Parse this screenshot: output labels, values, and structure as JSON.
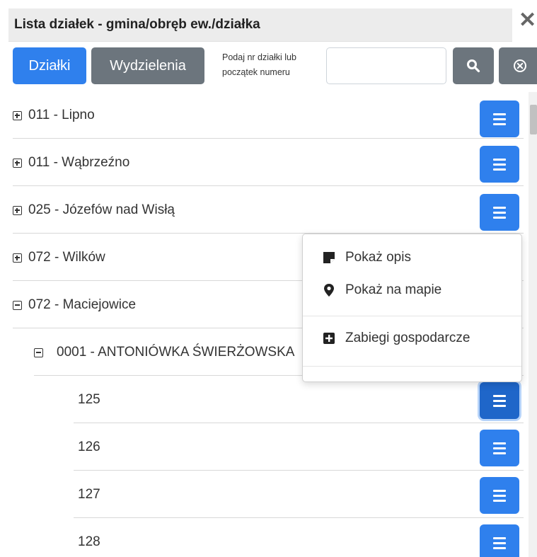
{
  "window": {
    "title": "Lista działek - gmina/obręb ew./działka",
    "close_symbol": "✕"
  },
  "toolbar": {
    "dzialki_label": "Działki",
    "wydzielenia_label": "Wydzielenia",
    "search_hint": "Podaj nr działki lub początek numeru",
    "search_value": "",
    "search_placeholder": "",
    "search_icon": "search-icon",
    "clear_icon": "clear-circle-icon"
  },
  "tree": {
    "rows": [
      {
        "label": "011 - Lipno",
        "toggle": "plus"
      },
      {
        "label": "011 - Wąbrzeźno",
        "toggle": "plus"
      },
      {
        "label": "025 - Józefów nad Wisłą",
        "toggle": "plus"
      },
      {
        "label": "072 - Wilków",
        "toggle": "plus"
      },
      {
        "label": "072 - Maciejowice",
        "toggle": "minus"
      },
      {
        "label": "0001 - ANTONIÓWKA ŚWIERŻOWSKA",
        "toggle": "minus"
      },
      {
        "label": "125"
      },
      {
        "label": "126"
      },
      {
        "label": "127"
      },
      {
        "label": "128"
      }
    ]
  },
  "context_menu": {
    "items": [
      {
        "label": "Pokaż opis",
        "icon": "note-icon"
      },
      {
        "label": "Pokaż na mapie",
        "icon": "map-marker-icon"
      },
      {
        "label": "Zabiegi gospodarcze",
        "icon": "plus-square-icon"
      }
    ]
  },
  "colors": {
    "primary": "#2f80ed",
    "secondary": "#6c757d"
  }
}
